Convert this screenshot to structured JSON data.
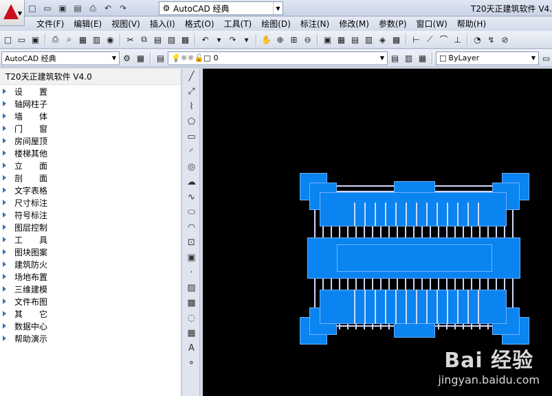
{
  "title": {
    "workspace": "AutoCAD 经典",
    "window_title": "T20天正建筑软件 V4."
  },
  "menu": [
    "文件(F)",
    "编辑(E)",
    "视图(V)",
    "插入(I)",
    "格式(O)",
    "工具(T)",
    "绘图(D)",
    "标注(N)",
    "修改(M)",
    "参数(P)",
    "窗口(W)",
    "帮助(H)"
  ],
  "toolbar2": {
    "workspace": "AutoCAD 经典",
    "layer": "0",
    "color": "ByLayer"
  },
  "panel": {
    "title": "T20天正建筑软件 V4.0",
    "items": [
      "设　　置",
      "轴网柱子",
      "墙　　体",
      "门　　窗",
      "房间屋顶",
      "楼梯其他",
      "立　　面",
      "剖　　面",
      "文字表格",
      "尺寸标注",
      "符号标注",
      "图层控制",
      "工　　具",
      "图块图案",
      "建筑防火",
      "场地布置",
      "三维建模",
      "文件布图",
      "其　　它",
      "数据中心",
      "帮助演示"
    ]
  },
  "draw_tools": [
    "line-icon",
    "xline-icon",
    "polyline-icon",
    "polygon-icon",
    "rectangle-icon",
    "arc-icon",
    "circle-icon",
    "revcloud-icon",
    "spline-icon",
    "ellipse-icon",
    "ellipse-arc-icon",
    "insert-block-icon",
    "make-block-icon",
    "point-icon",
    "hatch-icon",
    "gradient-icon",
    "region-icon",
    "table-icon",
    "mtext-icon",
    "add-selected-icon"
  ],
  "watermark": {
    "brand": "Bai 经验",
    "url": "jingyan.baidu.com"
  },
  "colors": {
    "canvas": "#000000",
    "blue": "#0a84f0",
    "accent": "#c8101f"
  }
}
